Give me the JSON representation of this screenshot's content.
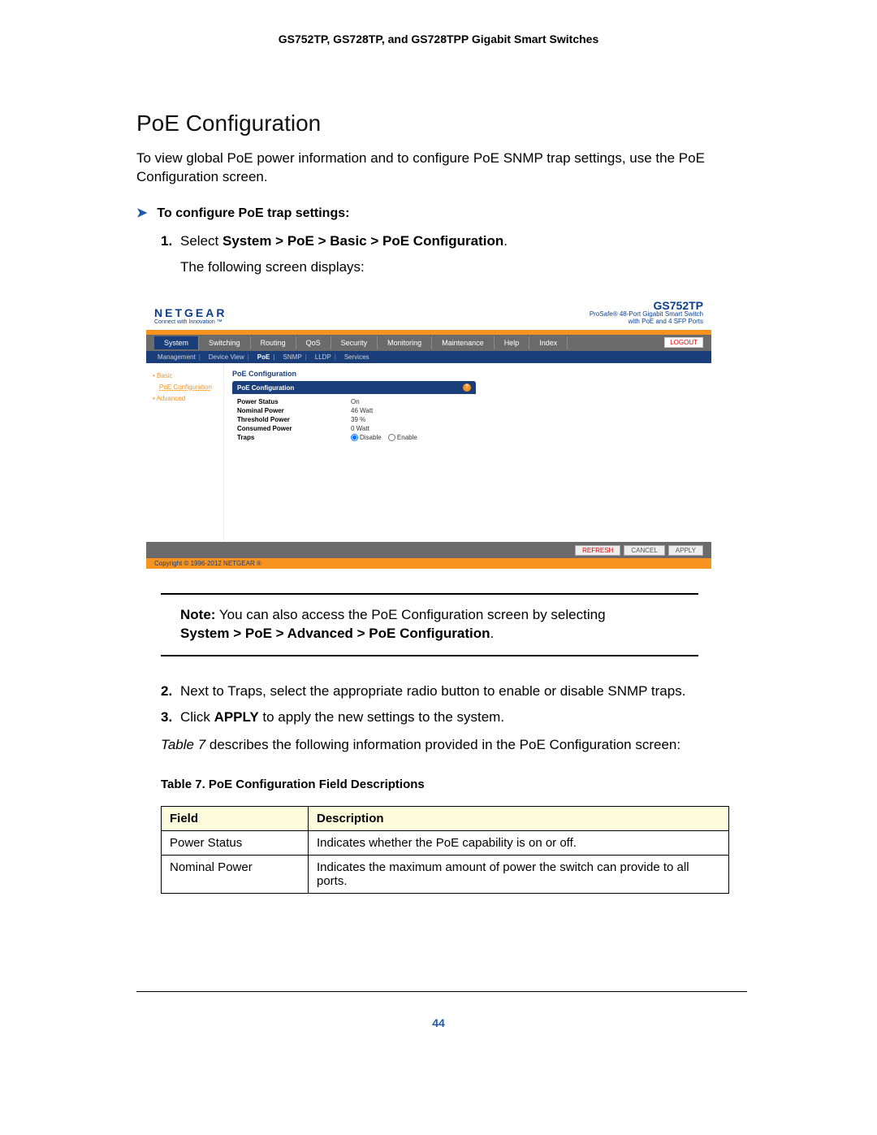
{
  "doc_header": "GS752TP, GS728TP, and GS728TPP Gigabit Smart Switches",
  "section_title": "PoE Configuration",
  "intro": "To view global PoE power information and to configure PoE SNMP trap settings, use the PoE Configuration screen.",
  "procedure_heading": "To configure PoE trap settings:",
  "steps": {
    "s1_num": "1.",
    "s1_prefix": "Select ",
    "s1_bold": "System > PoE > Basic > PoE Configuration",
    "s1_suffix": ".",
    "s1_sub": "The following screen displays:",
    "s2_num": "2.",
    "s2_text": "Next to Traps, select the appropriate radio button to enable or disable SNMP traps.",
    "s3_num": "3.",
    "s3_prefix": "Click ",
    "s3_bold": "APPLY",
    "s3_suffix": " to apply the new settings to the system."
  },
  "note": {
    "prefix": "Note:",
    "line1_rest": " You can also access the PoE Configuration screen by selecting ",
    "line2_bold": "System > PoE > Advanced > PoE Configuration",
    "line2_suffix": "."
  },
  "table_ref_italic": "Table 7",
  "table_ref_rest": " describes the following information provided in the PoE Configuration screen:",
  "table_caption": "Table 7.  PoE Configuration Field Descriptions",
  "field_table": {
    "h1": "Field",
    "h2": "Description",
    "r1c1": "Power Status",
    "r1c2": "Indicates whether the PoE capability is on or off.",
    "r2c1": "Nominal Power",
    "r2c2": "Indicates the maximum amount of power the switch can provide to all ports."
  },
  "page_number": "44",
  "screenshot": {
    "brand": "NETGEAR",
    "brand_tag": "Connect with Innovation ™",
    "model": "GS752TP",
    "model_line1": "ProSafe® 48-Port Gigabit Smart Switch",
    "model_line2": "with PoE and 4 SFP Ports",
    "logout": "LOGOUT",
    "tabs": [
      "System",
      "Switching",
      "Routing",
      "QoS",
      "Security",
      "Monitoring",
      "Maintenance",
      "Help",
      "Index"
    ],
    "subtabs": [
      "Management",
      "Device View",
      "PoE",
      "SNMP",
      "LLDP",
      "Services"
    ],
    "sidebar": {
      "basic": "Basic",
      "subitem": "PoE Configuration",
      "advanced": "Advanced"
    },
    "panel_title": "PoE Configuration",
    "panel_header": "PoE Configuration",
    "rows": {
      "power_status_l": "Power Status",
      "power_status_v": "On",
      "nominal_power_l": "Nominal Power",
      "nominal_power_v": "46 Watt",
      "threshold_power_l": "Threshold Power",
      "threshold_power_v": "39 %",
      "consumed_power_l": "Consumed Power",
      "consumed_power_v": "0 Watt",
      "traps_l": "Traps",
      "disable": "Disable",
      "enable": "Enable"
    },
    "buttons": {
      "refresh": "REFRESH",
      "cancel": "CANCEL",
      "apply": "APPLY"
    },
    "copyright": "Copyright © 1996-2012 NETGEAR ®"
  }
}
